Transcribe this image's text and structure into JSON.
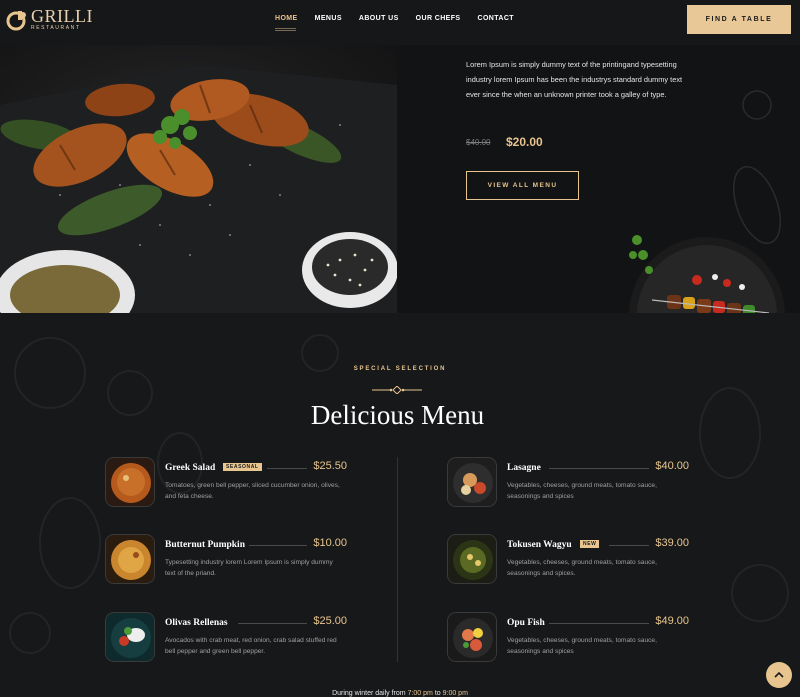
{
  "brand": {
    "name": "GRILLI",
    "tagline": "RESTAURANT"
  },
  "nav": {
    "items": [
      {
        "label": "HOME",
        "active": true
      },
      {
        "label": "MENUS",
        "active": false
      },
      {
        "label": "ABOUT US",
        "active": false
      },
      {
        "label": "OUR CHEFS",
        "active": false
      },
      {
        "label": "CONTACT",
        "active": false
      }
    ],
    "cta_label": "FIND A TABLE"
  },
  "hero": {
    "description": "Lorem Ipsum is simply dummy text of the printingand typesetting industry lorem Ipsum has been the industrys standard dummy text ever since the when an unknown printer took a galley of type.",
    "old_price": "$40.00",
    "new_price": "$20.00",
    "button_label": "VIEW ALL MENU"
  },
  "menu": {
    "eyebrow": "SPECIAL SELECTION",
    "title": "Delicious Menu",
    "left": [
      {
        "name": "Greek Salad",
        "badge": "SEASONAL",
        "price": "$25.50",
        "desc": "Tomatoes, green bell pepper, sliced cucumber onion, olives, and feta cheese."
      },
      {
        "name": "Butternut Pumpkin",
        "badge": "",
        "price": "$10.00",
        "desc": "Typesetting industry lorem Lorem Ipsum is simply dummy text of the priand."
      },
      {
        "name": "Olivas Rellenas",
        "badge": "",
        "price": "$25.00",
        "desc": "Avocados with crab meat, red onion, crab salad stuffed red bell pepper and green bell pepper."
      }
    ],
    "right": [
      {
        "name": "Lasagne",
        "badge": "",
        "price": "$40.00",
        "desc": "Vegetables, cheeses, ground meats, tomato sauce, seasonings and spices"
      },
      {
        "name": "Tokusen Wagyu",
        "badge": "NEW",
        "price": "$39.00",
        "desc": "Vegetables, cheeses, ground meats, tomato sauce, seasonings and spices."
      },
      {
        "name": "Opu Fish",
        "badge": "",
        "price": "$49.00",
        "desc": "Vegetables, cheeses, ground meats, tomato sauce, seasonings and spices"
      }
    ]
  },
  "footer": {
    "prefix": "During winter daily from",
    "from": "7:00 pm",
    "mid": "to",
    "to": "9:00 pm"
  },
  "colors": {
    "accent": "#e8c58f",
    "background": "#121314",
    "panel": "#171819"
  }
}
